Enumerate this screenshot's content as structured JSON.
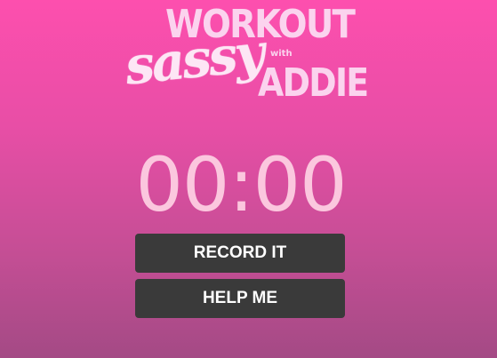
{
  "logo": {
    "line1": "WORKOUT",
    "script": "sassy",
    "with": "with",
    "line2": "ADDIE"
  },
  "timer": {
    "display": "00:00"
  },
  "buttons": {
    "record_label": "RECORD IT",
    "help_label": "HELP ME"
  },
  "colors": {
    "background_top": "#fd4fae",
    "background_bottom": "#a44a85",
    "logo_text": "#fbd3ee",
    "timer_text": "#fbc7de",
    "button_bg": "#3a3a3a",
    "button_text": "#ffffff"
  }
}
